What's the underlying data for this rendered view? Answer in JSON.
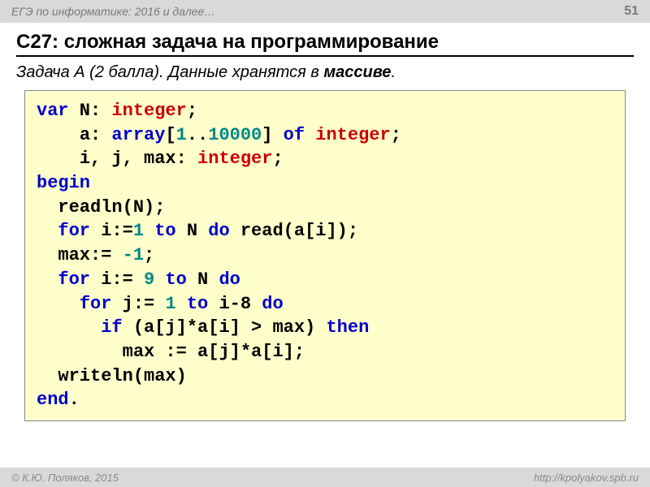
{
  "header": {
    "title": "ЕГЭ по информатике: 2016 и далее…",
    "page": "51"
  },
  "title": "C27: сложная задача на программирование",
  "subtitle": {
    "prefix": "Задача А",
    "points": " (2 балла). Данные хранятся в ",
    "bold_word": "массиве",
    "suffix": "."
  },
  "code": {
    "l1": {
      "kw": "var",
      "v1": " N",
      "colon": ": ",
      "t1": "integer",
      "semi": ";"
    },
    "l2": {
      "pad": "    ",
      "v": "a",
      "colon": ": ",
      "kw": "array",
      "lb": "[",
      "n1": "1",
      "dots": "..",
      "n2": "10000",
      "rb": "] ",
      "of": "of ",
      "t": "integer",
      "semi": ";"
    },
    "l3": {
      "pad": "    ",
      "v": "i, j, max",
      "colon": ": ",
      "t": "integer",
      "semi": ";"
    },
    "l4": {
      "kw": "begin"
    },
    "l5": {
      "pad": "  ",
      "fn": "readln(N);"
    },
    "l6": {
      "pad": "  ",
      "kw1": "for",
      "v1": " i:=",
      "n1": "1",
      "sp": " ",
      "kw2": "to",
      "v2": " N ",
      "kw3": "do",
      "sp2": " ",
      "fn": "read(a[i]);"
    },
    "l7": {
      "pad": "  ",
      "v": "max:= ",
      "n": "-1",
      "semi": ";"
    },
    "l8": {
      "pad": "  ",
      "kw1": "for",
      "v1": " i:= ",
      "n1": "9",
      "sp": " ",
      "kw2": "to",
      "v2": " N ",
      "kw3": "do"
    },
    "l9": {
      "pad": "    ",
      "kw1": "for",
      "v1": " j:= ",
      "n1": "1",
      "sp": " ",
      "kw2": "to",
      "v2": " i-8 ",
      "kw3": "do"
    },
    "l10": {
      "pad": "      ",
      "kw1": "if",
      "expr": " (a[j]*a[i] > max) ",
      "kw2": "then"
    },
    "l11": {
      "pad": "        ",
      "stmt": "max := a[j]*a[i];"
    },
    "l12": {
      "pad": "  ",
      "fn": "writeln(max)"
    },
    "l13": {
      "kw": "end",
      "dot": "."
    }
  },
  "footer": {
    "left": "© К.Ю. Поляков, 2015",
    "right": "http://kpolyakov.spb.ru"
  }
}
